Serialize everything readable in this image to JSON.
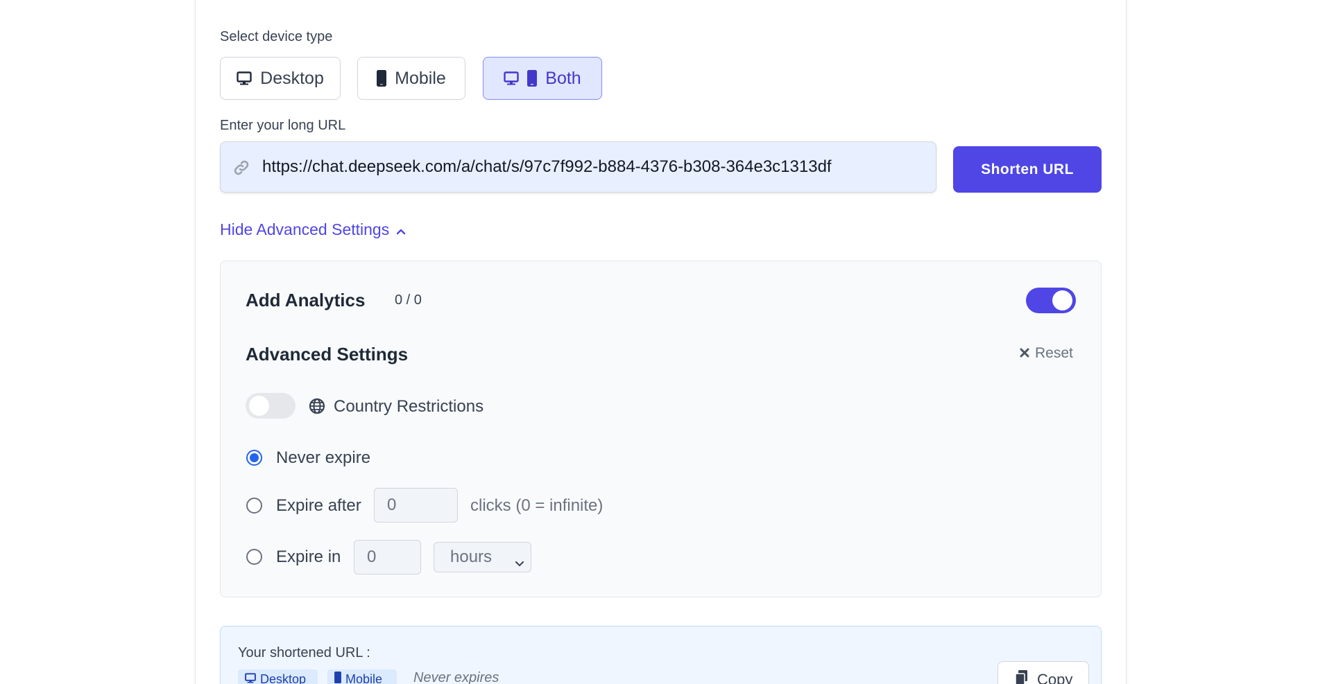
{
  "device": {
    "label": "Select device type",
    "options": [
      {
        "label": "Desktop",
        "icon": "desktop-icon"
      },
      {
        "label": "Mobile",
        "icon": "mobile-icon"
      },
      {
        "label": "Both",
        "icon": "desktop-mobile-icon",
        "selected": true
      }
    ]
  },
  "url": {
    "label": "Enter your long URL",
    "value": "https://chat.deepseek.com/a/chat/s/97c7f992-b884-4376-b308-364e3c1313df",
    "icon": "link-icon",
    "submit_label": "Shorten URL"
  },
  "advanced_toggle": {
    "label": "Hide Advanced Settings",
    "icon": "chevron-up-icon"
  },
  "analytics": {
    "title": "Add Analytics",
    "count": "0 / 0",
    "enabled": true
  },
  "advanced": {
    "title": "Advanced Settings",
    "reset_label": "Reset",
    "country_label": "Country Restrictions",
    "country_enabled": false,
    "expiry": {
      "never_label": "Never expire",
      "after_label": "Expire after",
      "after_value": "0",
      "after_hint": "clicks (0 = infinite)",
      "in_label": "Expire in",
      "in_value": "0",
      "in_unit": "hours",
      "selected": "never"
    }
  },
  "result": {
    "label": "Your shortened URL :",
    "badges": [
      "Desktop",
      "Mobile"
    ],
    "expires_text": "Never expires",
    "copy_label": "Copy"
  },
  "colors": {
    "accent": "#4f46e5",
    "radio": "#2563eb",
    "selected_bg": "#e0e7ff"
  }
}
